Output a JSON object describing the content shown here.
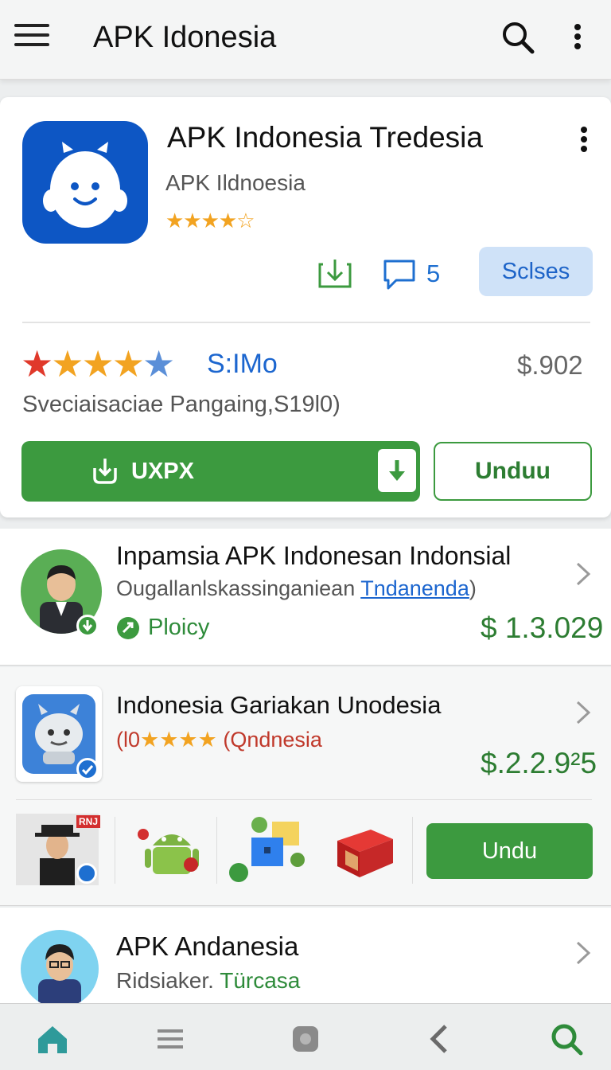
{
  "appbar": {
    "title": "APK Idonesia",
    "menu_icon": "menu-icon",
    "search_icon": "search-icon",
    "more_icon": "more-vert-icon"
  },
  "featured": {
    "name": "APK Indonesia Tredesia",
    "developer": "APK Ildnoesia",
    "stars_small": "★★★★☆",
    "comments_count": "5",
    "chip_label": "Sclses",
    "rating_label": "S:IMo",
    "price": "$.902",
    "subtitle": "Sveciaisaciae  Pangaing,S19l0)",
    "install_label": "UXPX",
    "unduh_label": "Unduu",
    "colors": {
      "brand_blue": "#0d56c4",
      "green": "#3c9a3f",
      "link_blue": "#1c66cf"
    }
  },
  "apps": [
    {
      "title": "Inpamsia APK Indonesan Indonsial",
      "subtitle": "Ougallanlskassinganiean ",
      "subtitle_link": "Tndanenda",
      "subtitle_end": ")",
      "policy": "Ploicy",
      "price": "$ 1.3.029"
    },
    {
      "title": "Indonesia Gariakan Unodesia",
      "subtitle_prefix": "(l0",
      "subtitle_stars": "★★★★",
      "subtitle": "(Qndnesia",
      "price": "$.2.2.9²5",
      "thumb_badge": "RNJ",
      "button_label": "Undu"
    },
    {
      "title": "APK Andanesia",
      "subtitle": "Ridsiaker. ",
      "subtitle_green": "Türcasa"
    }
  ],
  "bottom_nav": [
    "home-icon",
    "list-icon",
    "square-icon",
    "back-icon",
    "search-icon"
  ]
}
